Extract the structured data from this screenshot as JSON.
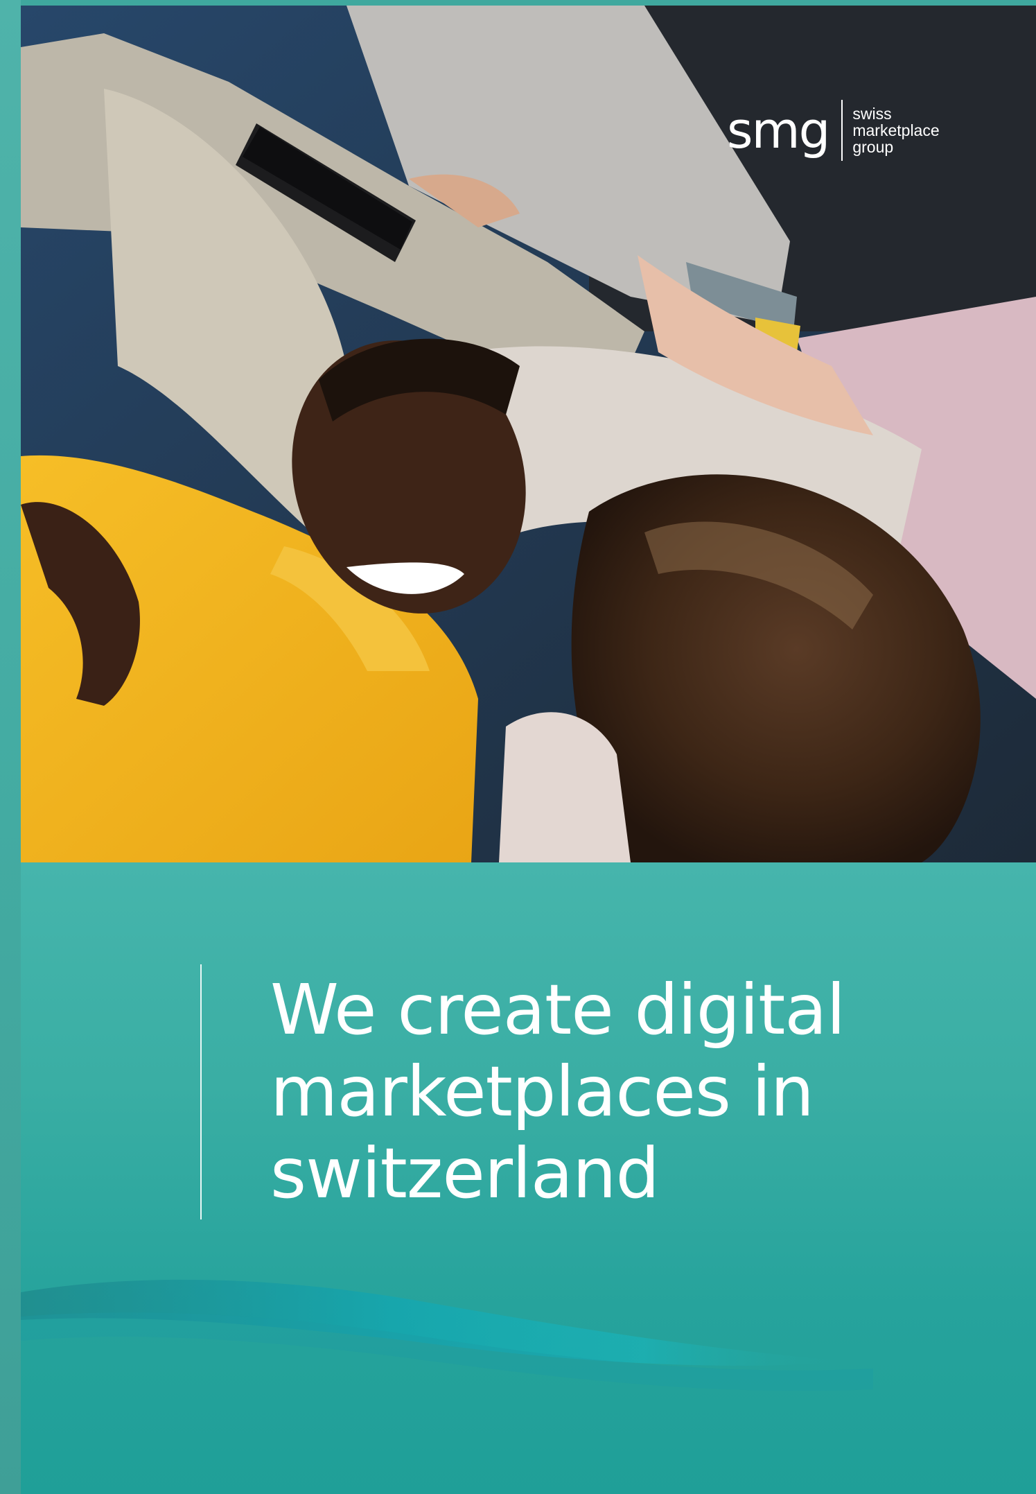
{
  "brand": {
    "mark": "smg",
    "words": [
      "swiss",
      "marketplace",
      "group"
    ]
  },
  "headline": {
    "lines": [
      "We create digital",
      "marketplaces in",
      "switzerland"
    ]
  },
  "colors": {
    "accent_teal": "#2aa69c",
    "text_white": "#ffffff",
    "sweater_yellow": "#f2b41e"
  }
}
